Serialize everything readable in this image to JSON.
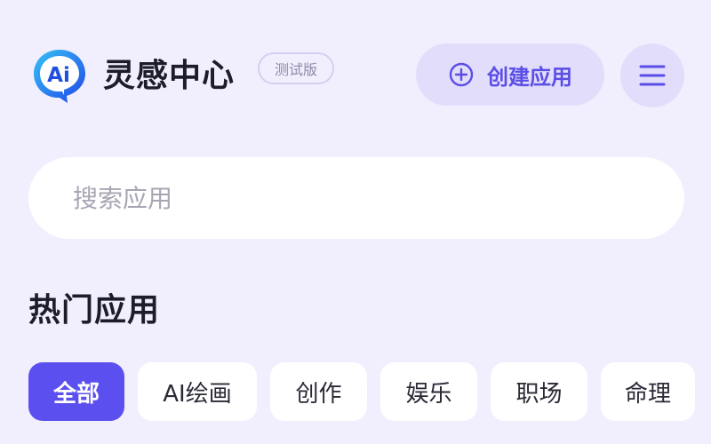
{
  "header": {
    "logo_text": "Ai",
    "title": "灵感中心",
    "beta_badge": "测试版",
    "create_button_label": "创建应用",
    "create_icon": "plus-circle-icon",
    "menu_icon": "hamburger-menu-icon"
  },
  "search": {
    "placeholder": "搜索应用",
    "value": ""
  },
  "section": {
    "title": "热门应用"
  },
  "categories": [
    {
      "label": "全部",
      "active": true
    },
    {
      "label": "AI绘画",
      "active": false
    },
    {
      "label": "创作",
      "active": false
    },
    {
      "label": "娱乐",
      "active": false
    },
    {
      "label": "职场",
      "active": false
    },
    {
      "label": "命理",
      "active": false
    }
  ],
  "colors": {
    "background": "#f1effd",
    "accent": "#5b4ff0",
    "button_bg": "#e1ddfb",
    "logo_blue": "#1f6cf2"
  }
}
